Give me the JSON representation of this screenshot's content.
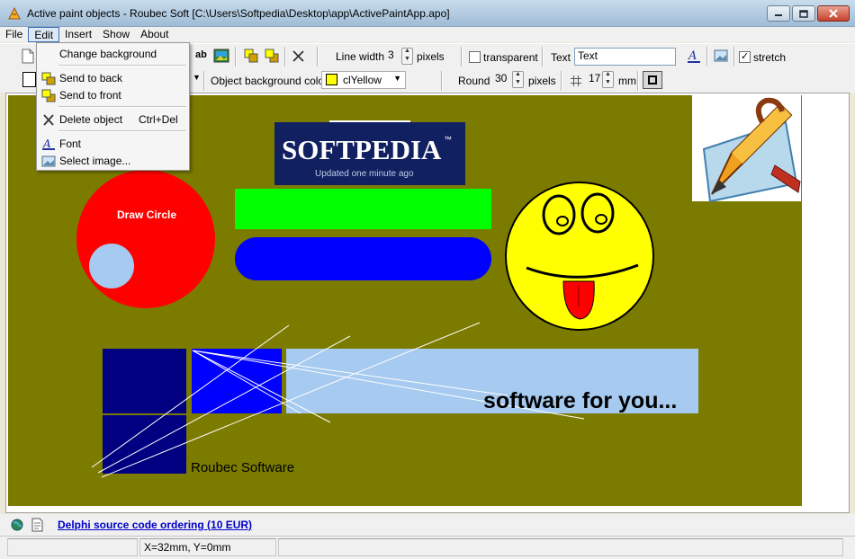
{
  "window": {
    "title": "Active paint objects - Roubec Soft [C:\\Users\\Softpedia\\Desktop\\app\\ActivePaintApp.apo]",
    "icons": [
      "app-icon",
      "minimize-icon",
      "maximize-icon",
      "close-icon"
    ]
  },
  "menubar": {
    "items": [
      "File",
      "Edit",
      "Insert",
      "Show",
      "About"
    ],
    "active": "Edit"
  },
  "edit_menu": {
    "items": [
      {
        "label": "Change background",
        "shortcut": "",
        "icon": "background-icon"
      },
      {
        "label": "Send to back",
        "shortcut": "",
        "icon": "send-to-back-icon"
      },
      {
        "label": "Send to front",
        "shortcut": "",
        "icon": "send-to-front-icon"
      },
      {
        "label": "Delete object",
        "shortcut": "Ctrl+Del",
        "icon": "delete-icon"
      },
      {
        "label": "Font",
        "shortcut": "",
        "icon": "font-icon"
      },
      {
        "label": "Select image...",
        "shortcut": "",
        "icon": "image-icon"
      }
    ]
  },
  "toolbar1": {
    "line_width_label": "Line width",
    "line_width_value": "3",
    "line_width_unit": "pixels",
    "transparent_label": "transparent",
    "transparent_checked": false,
    "text_label": "Text",
    "text_value": "Text",
    "stretch_label": "stretch",
    "stretch_checked": true,
    "text_tool_label": "ab"
  },
  "toolbar2": {
    "obj_bg_label": "Object background color",
    "obj_bg_value": "clYellow",
    "obj_bg_color": "#ffff00",
    "round_label": "Round",
    "round_value": "30",
    "round_unit": "pixels",
    "grid_value": "17",
    "grid_unit": "mm"
  },
  "canvas": {
    "background_color": "#7b7b00",
    "circle_label": "Draw Circle",
    "softpedia_logo": "SOFTPEDIA",
    "softpedia_tm": "™",
    "softpedia_tagline": "Updated one minute ago",
    "banner_text": "software for you...",
    "company_text": "Roubec Software",
    "colors": {
      "red_circle": "#ff0000",
      "small_circle": "#a6caf0",
      "green_rect": "#00ff00",
      "blue_pill": "#0000ff",
      "smiley": "#ffff00",
      "tongue": "#ff0000",
      "navy": "#000080",
      "blue": "#0000ff",
      "light_blue": "#a6caf0",
      "softpedia_bg": "#102060"
    }
  },
  "link": {
    "text": "Delphi source code ordering (10 EUR)"
  },
  "status": {
    "coords": "X=32mm, Y=0mm"
  }
}
